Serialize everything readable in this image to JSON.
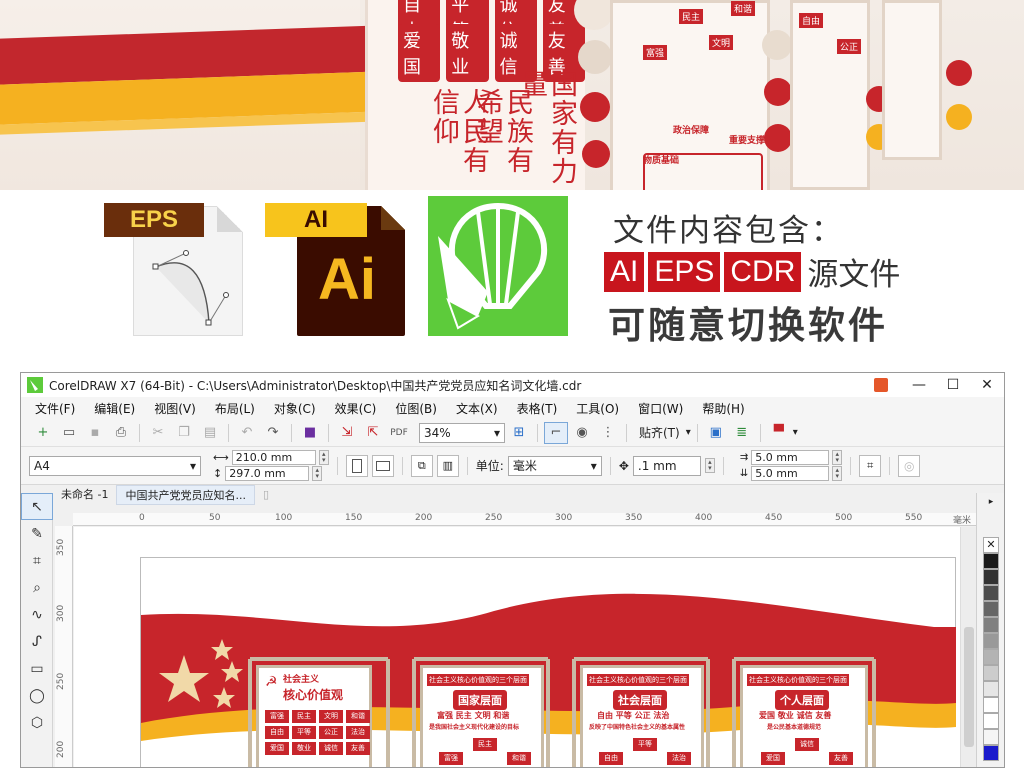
{
  "photo": {
    "tags_row1": [
      "自由",
      "平等",
      "诚信",
      "友善"
    ],
    "tags_row2": [
      "爱国",
      "敬业",
      "诚信",
      "友善"
    ],
    "vertical_cols": [
      "国家有力量",
      "民族有希望",
      "人民有信仰"
    ],
    "board2": {
      "tags": [
        "民主",
        "和谐",
        "富强",
        "文明"
      ],
      "text_lines": [
        "政治保障",
        "重要支撑",
        "物质基础"
      ]
    },
    "board3_tags": [
      "自由",
      "公正"
    ]
  },
  "formats": {
    "eps_label": "EPS",
    "ai_label": "AI",
    "ai_big": "Ai",
    "title": "文件内容包含：",
    "badges": [
      "AI",
      "EPS",
      "CDR"
    ],
    "badges_tail": "源文件",
    "subtitle": "可随意切换软件",
    "colors": {
      "badge_red": "#c8151d",
      "cdr_green": "#5dcb3b",
      "ai_dark": "#3a0c00",
      "ai_yellow": "#f7c41c",
      "eps_brown": "#6a2e0c"
    }
  },
  "window": {
    "title": "CorelDRAW X7 (64-Bit) - C:\\Users\\Administrator\\Desktop\\中国共产党党员应知名词文化墙.cdr",
    "controls": [
      "minimize-icon",
      "maximize-icon",
      "close-icon"
    ],
    "menu": [
      "文件(F)",
      "编辑(E)",
      "视图(V)",
      "布局(L)",
      "对象(C)",
      "效果(C)",
      "位图(B)",
      "文本(X)",
      "表格(T)",
      "工具(O)",
      "窗口(W)",
      "帮助(H)"
    ],
    "toolbar": {
      "zoom": "34%",
      "snap_label": "贴齐(T)"
    },
    "property_bar": {
      "page_size": "A4",
      "width": "210.0 mm",
      "height": "297.0 mm",
      "units_label": "单位:",
      "units_value": "毫米",
      "nudge": ".1 mm",
      "dup_x": "5.0 mm",
      "dup_y": "5.0 mm"
    },
    "tabs": [
      "未命名 -1",
      "中国共产党党员应知名..."
    ],
    "ruler": {
      "h_ticks": [
        "0",
        "50",
        "100",
        "150",
        "200",
        "250",
        "300",
        "350",
        "400",
        "450",
        "500",
        "550"
      ],
      "h_unit": "毫米",
      "v_ticks": [
        "350",
        "300",
        "250",
        "200"
      ]
    },
    "palette": [
      "none",
      "#1a1a1a",
      "#333333",
      "#4d4d4d",
      "#666666",
      "#808080",
      "#999999",
      "#b3b3b3",
      "#cccccc",
      "#e6e6e6",
      "#ffffff",
      "#ffffff",
      "#f5f5f5",
      "#1a1acc"
    ]
  },
  "design": {
    "colors": {
      "red": "#c7252b",
      "yellow": "#f5b120",
      "gold": "#c9bba5"
    },
    "panel1": {
      "title_small": "社会主义",
      "title_big": "核心价值观",
      "cells": [
        "富强",
        "民主",
        "文明",
        "和谐",
        "自由",
        "平等",
        "公正",
        "法治",
        "爱国",
        "敬业",
        "诚信",
        "友善"
      ]
    },
    "panel2": {
      "header": "社会主义核心价值观的三个层面",
      "big": "国家层面",
      "words": "富强 民主 文明 和谐",
      "caption": "是我国社会主义现代化建设的目标",
      "nodes": [
        "民主",
        "富强",
        "和谐"
      ]
    },
    "panel3": {
      "header": "社会主义核心价值观的三个层面",
      "big": "社会层面",
      "words": "自由 平等 公正 法治",
      "caption": "反映了中国特色社会主义的基本属性",
      "nodes": [
        "平等",
        "自由",
        "法治"
      ]
    },
    "panel4": {
      "header": "社会主义核心价值观的三个层面",
      "big": "个人层面",
      "words": "爱国 敬业 诚信 友善",
      "caption": "是公民基本道德规范",
      "nodes": [
        "诚信",
        "爱国",
        "友善"
      ]
    }
  }
}
